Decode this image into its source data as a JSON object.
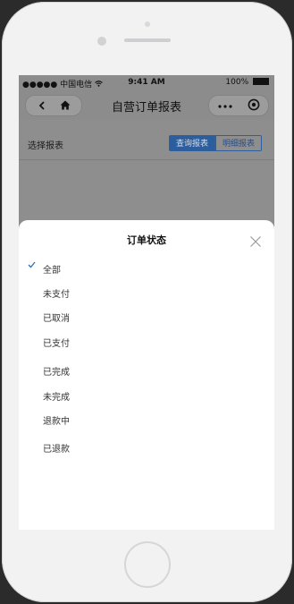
{
  "status_bar": {
    "carrier": "●●●●● 中国电信",
    "time": "9:41 AM",
    "battery": "100%"
  },
  "nav": {
    "title": "自营订单报表"
  },
  "report": {
    "label": "选择报表",
    "tabs": [
      "查询报表",
      "明细报表"
    ]
  },
  "sheet": {
    "title": "订单状态",
    "options": [
      {
        "label": "全部",
        "selected": true
      },
      {
        "label": "未支付",
        "selected": false
      },
      {
        "label": "已取消",
        "selected": false
      },
      {
        "label": "已支付",
        "selected": false
      },
      {
        "label": "已完成",
        "selected": false
      },
      {
        "label": "未完成",
        "selected": false
      },
      {
        "label": "退款中",
        "selected": false
      },
      {
        "label": "已退款",
        "selected": false
      }
    ]
  },
  "colors": {
    "accent": "#2f6fb8",
    "overlay": "#8c8c8c",
    "sheet": "#ffffff"
  }
}
